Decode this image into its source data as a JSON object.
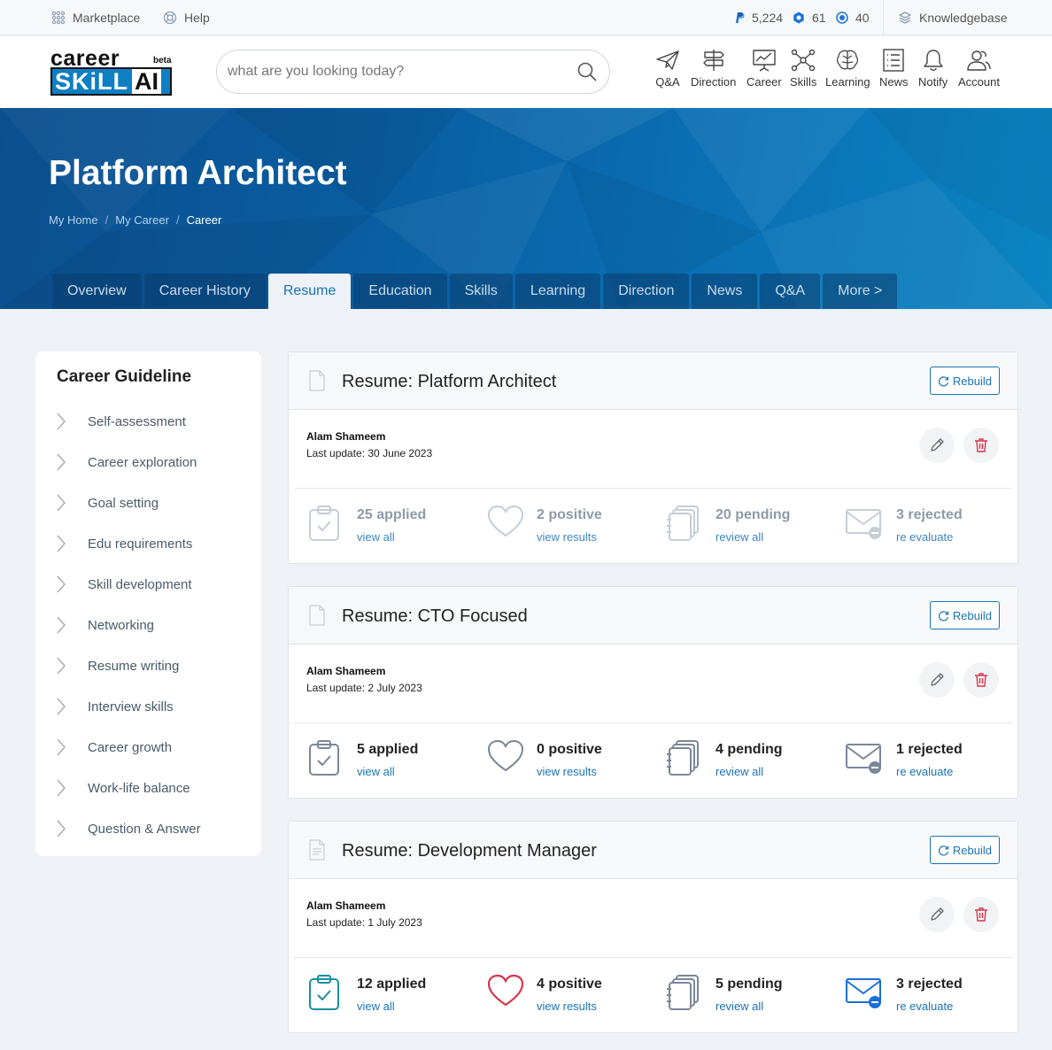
{
  "topbar": {
    "marketplace": "Marketplace",
    "help": "Help",
    "paypal_count": "5,224",
    "badge_count": "61",
    "point_count": "40",
    "knowledgebase": "Knowledgebase"
  },
  "logo": {
    "top": "career",
    "beta": "beta",
    "skill": "SKiLL",
    "ai": "AI"
  },
  "search": {
    "placeholder": "what are you looking today?"
  },
  "nav": {
    "qa": "Q&A",
    "direction": "Direction",
    "career": "Career",
    "skills": "Skills",
    "learning": "Learning",
    "news": "News",
    "notify": "Notify",
    "account": "Account"
  },
  "hero": {
    "title": "Platform Architect",
    "breadcrumbs": [
      "My Home",
      "My Career",
      "Career"
    ]
  },
  "tabs": [
    "Overview",
    "Career History",
    "Resume",
    "Education",
    "Skills",
    "Learning",
    "Direction",
    "News",
    "Q&A",
    "More >"
  ],
  "sidebar": {
    "title": "Career Guideline",
    "items": [
      "Self-assessment",
      "Career exploration",
      "Goal setting",
      "Edu requirements",
      "Skill development",
      "Networking",
      "Resume writing",
      "Interview skills",
      "Career growth",
      "Work-life balance",
      "Question & Answer"
    ]
  },
  "resumes": [
    {
      "title": "Resume: Platform Architect",
      "rebuild": "Rebuild",
      "owner": "Alam Shameem",
      "updated": "Last update: 30 June 2023",
      "applied": "25 applied",
      "applied_link": "view all",
      "positive": "2 positive",
      "positive_link": "view results",
      "pending": "20 pending",
      "pending_link": "review all",
      "rejected": "3 rejected",
      "rejected_link": "re evaluate"
    },
    {
      "title": "Resume: CTO Focused",
      "rebuild": "Rebuild",
      "owner": "Alam Shameem",
      "updated": "Last update: 2 July 2023",
      "applied": "5 applied",
      "applied_link": "view all",
      "positive": "0 positive",
      "positive_link": "view results",
      "pending": "4 pending",
      "pending_link": "review all",
      "rejected": "1 rejected",
      "rejected_link": "re evaluate"
    },
    {
      "title": "Resume: Development Manager",
      "rebuild": "Rebuild",
      "owner": "Alam Shameem",
      "updated": "Last update: 1 July 2023",
      "applied": "12 applied",
      "applied_link": "view all",
      "positive": "4 positive",
      "positive_link": "view results",
      "pending": "5 pending",
      "pending_link": "review all",
      "rejected": "3 rejected",
      "rejected_link": "re evaluate"
    }
  ],
  "colors": {
    "brand": "#0e7fc3",
    "link": "#1a73b8",
    "danger": "#d9364a",
    "teal": "#1a8fa0"
  }
}
